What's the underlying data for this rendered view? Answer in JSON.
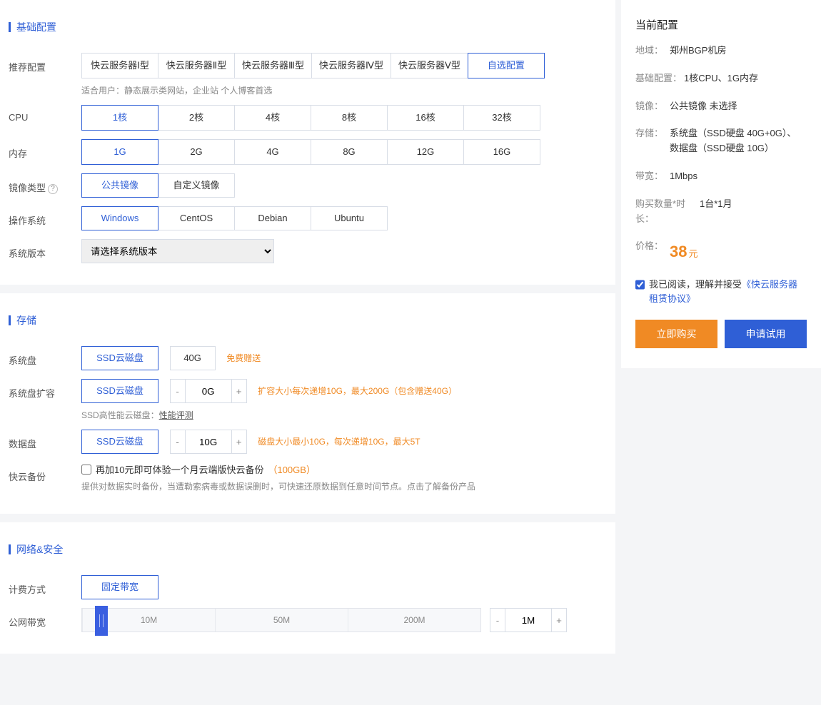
{
  "sections": {
    "basic": "基础配置",
    "storage": "存储",
    "network": "网络&安全"
  },
  "recommended": {
    "label": "推荐配置",
    "options": [
      "快云服务器Ⅰ型",
      "快云服务器Ⅱ型",
      "快云服务器Ⅲ型",
      "快云服务器Ⅳ型",
      "快云服务器Ⅴ型",
      "自选配置"
    ],
    "active": "自选配置",
    "hint": "适合用户：静态展示类网站，企业站 个人博客首选"
  },
  "cpu": {
    "label": "CPU",
    "options": [
      "1核",
      "2核",
      "4核",
      "8核",
      "16核",
      "32核"
    ],
    "active": "1核"
  },
  "mem": {
    "label": "内存",
    "options": [
      "1G",
      "2G",
      "4G",
      "8G",
      "12G",
      "16G"
    ],
    "active": "1G"
  },
  "imageType": {
    "label": "镜像类型",
    "options": [
      "公共镜像",
      "自定义镜像"
    ],
    "active": "公共镜像"
  },
  "os": {
    "label": "操作系统",
    "options": [
      "Windows",
      "CentOS",
      "Debian",
      "Ubuntu"
    ],
    "active": "Windows"
  },
  "sysVersion": {
    "label": "系统版本",
    "placeholder": "请选择系统版本"
  },
  "sysDisk": {
    "label": "系统盘",
    "type": "SSD云磁盘",
    "size": "40G",
    "note": "免费赠送"
  },
  "sysExpand": {
    "label": "系统盘扩容",
    "type": "SSD云磁盘",
    "size": "0G",
    "note": "扩容大小每次递增10G，最大200G（包含赠送40G）",
    "sub": "SSD高性能云磁盘：",
    "subLink": "性能评测"
  },
  "dataDisk": {
    "label": "数据盘",
    "type": "SSD云磁盘",
    "size": "10G",
    "note": "磁盘大小最小10G，每次递增10G，最大5T"
  },
  "backup": {
    "label": "快云备份",
    "checkbox": "再加10元即可体验一个月云端版快云备份",
    "tag": "（100GB）",
    "desc": "提供对数据实时备份，当遭勒索病毒或数据误删时，可快速还原数据到任意时间节点。",
    "link": "点击了解备份产品"
  },
  "billing": {
    "label": "计费方式",
    "option": "固定带宽"
  },
  "bandwidth": {
    "label": "公网带宽",
    "ticks": [
      "10M",
      "50M",
      "200M"
    ],
    "value": "1M"
  },
  "summary": {
    "title": "当前配置",
    "region": {
      "k": "地域：",
      "v": "郑州BGP机房"
    },
    "basic": {
      "k": "基础配置：",
      "v": "1核CPU、1G内存"
    },
    "image": {
      "k": "镜像：",
      "v": "公共镜像 未选择"
    },
    "storage": {
      "k": "存储：",
      "v": "系统盘（SSD硬盘 40G+0G）、 数据盘（SSD硬盘 10G）"
    },
    "bw": {
      "k": "带宽：",
      "v": "1Mbps"
    },
    "qty": {
      "k": "购买数量*时长：",
      "v": "1台*1月"
    },
    "priceLabel": "价格：",
    "price": "38",
    "priceUnit": "元",
    "agreePrefix": "我已阅读，理解并接受",
    "agreeLink": "《快云服务器租赁协议》",
    "buy": "立即购买",
    "try": "申请试用"
  }
}
